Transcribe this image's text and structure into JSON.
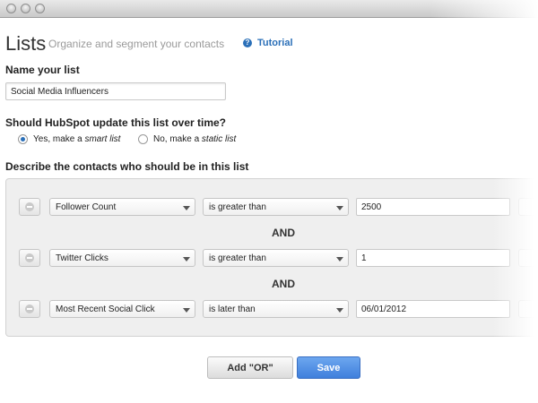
{
  "header": {
    "title": "Lists",
    "subtitle": "Organize and segment your contacts",
    "tutorial_label": "Tutorial",
    "help_glyph": "?"
  },
  "name_section": {
    "label": "Name your list",
    "value": "Social Media Influencers"
  },
  "update_section": {
    "label": "Should HubSpot update this list over time?",
    "options": [
      {
        "prefix": "Yes, make a ",
        "emphasis": "smart list",
        "checked": true
      },
      {
        "prefix": "No, make a ",
        "emphasis": "static list",
        "checked": false
      }
    ]
  },
  "criteria_section": {
    "label": "Describe the contacts who should be in this list",
    "rows": [
      {
        "property": "Follower Count",
        "operator": "is greater than",
        "value": "2500"
      },
      {
        "property": "Twitter Clicks",
        "operator": "is greater than",
        "value": "1"
      },
      {
        "property": "Most Recent Social Click",
        "operator": "is later than",
        "value": "06/01/2012"
      }
    ],
    "connectors": [
      "AND",
      "AND"
    ]
  },
  "actions": {
    "add_or_label": "Add \"OR\"",
    "save_label": "Save"
  },
  "colors": {
    "link": "#2a6fb8",
    "save_button": "#4a8be6"
  },
  "icons": {
    "help": "help-icon",
    "remove": "minus-circle-icon",
    "dropdown": "chevron-down-icon"
  }
}
